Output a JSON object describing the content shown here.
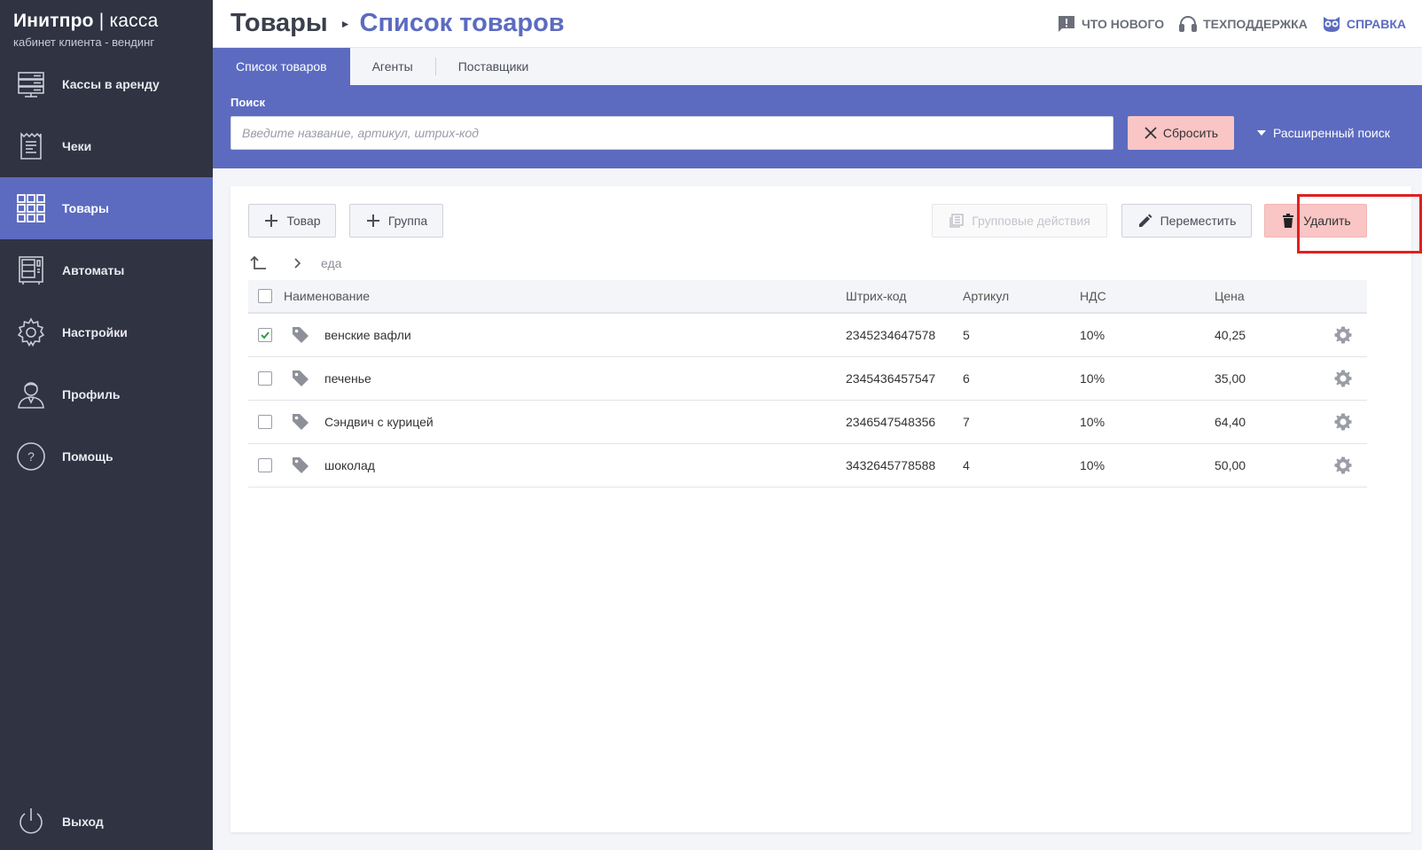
{
  "brand": {
    "title": "Инитпро",
    "title_sep": " | ",
    "title_light": "касса",
    "subtitle": "кабинет клиента - вендинг"
  },
  "sidebar": {
    "items": [
      {
        "label": "Кассы в аренду",
        "icon": "server-icon"
      },
      {
        "label": "Чеки",
        "icon": "receipt-icon"
      },
      {
        "label": "Товары",
        "icon": "grid-icon",
        "active": true
      },
      {
        "label": "Автоматы",
        "icon": "vending-machine-icon"
      },
      {
        "label": "Настройки",
        "icon": "gear-icon"
      },
      {
        "label": "Профиль",
        "icon": "user-icon"
      },
      {
        "label": "Помощь",
        "icon": "help-icon"
      }
    ],
    "logout": {
      "label": "Выход",
      "icon": "power-icon"
    }
  },
  "header": {
    "crumb_root": "Товары",
    "crumb_current": "Список товаров",
    "links": {
      "whats_new": "ЧТО НОВОГО",
      "support": "ТЕХПОДДЕРЖКА",
      "help": "СПРАВКА"
    }
  },
  "tabs": [
    "Список товаров",
    "Агенты",
    "Поставщики"
  ],
  "search": {
    "label": "Поиск",
    "placeholder": "Введите название, артикул, штрих-код",
    "value": "",
    "reset_label": "Сбросить",
    "advanced_label": "Расширенный поиск"
  },
  "toolbar": {
    "add_product": "Товар",
    "add_group": "Группа",
    "group_actions": "Групповые действия",
    "move": "Переместить",
    "delete": "Удалить"
  },
  "path": {
    "current": "еда"
  },
  "table": {
    "columns": [
      "Наименование",
      "Штрих-код",
      "Артикул",
      "НДС",
      "Цена"
    ],
    "rows": [
      {
        "name": "венские вафли",
        "barcode": "2345234647578",
        "article": "5",
        "vat": "10%",
        "price": "40,25",
        "checked": true
      },
      {
        "name": "печенье",
        "barcode": "2345436457547",
        "article": "6",
        "vat": "10%",
        "price": "35,00",
        "checked": false
      },
      {
        "name": "Сэндвич с курицей",
        "barcode": "2346547548356",
        "article": "7",
        "vat": "10%",
        "price": "64,40",
        "checked": false
      },
      {
        "name": "шоколад",
        "barcode": "3432645778588",
        "article": "4",
        "vat": "10%",
        "price": "50,00",
        "checked": false
      }
    ]
  },
  "colors": {
    "sidebar_bg": "#2f3342",
    "accent": "#5c6bc0",
    "danger_bg": "#f9c5c5",
    "highlight": "#e02020",
    "check": "#2e9d4a"
  }
}
